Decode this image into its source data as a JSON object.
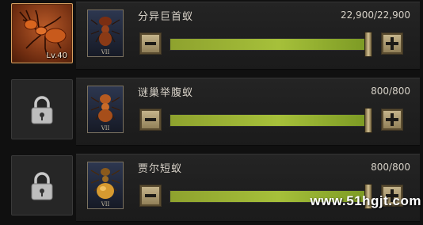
{
  "units": [
    {
      "name": "分异巨首蚁",
      "count": "22,900/22,900",
      "level": "Lv.40",
      "rank": "VII",
      "fill": 1.0,
      "unlocked": true
    },
    {
      "name": "谜巢举腹蚁",
      "count": "800/800",
      "rank": "VII",
      "fill": 1.0,
      "unlocked": false
    },
    {
      "name": "贾尔短蚁",
      "count": "800/800",
      "rank": "VII",
      "fill": 1.0,
      "unlocked": false
    }
  ],
  "icons": {
    "lock": "lock-icon",
    "minus": "minus-icon",
    "plus": "plus-icon"
  },
  "watermark": "www.51hgjt.com"
}
